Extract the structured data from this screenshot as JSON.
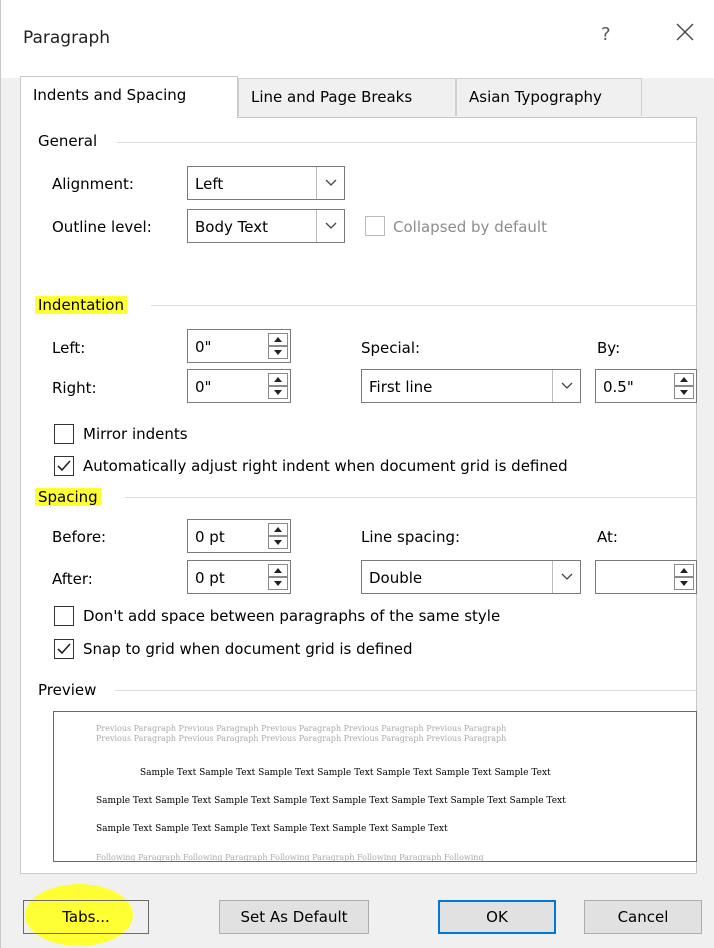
{
  "window": {
    "title": "Paragraph",
    "help_glyph": "?",
    "close_icon": "close-icon"
  },
  "tabs": [
    {
      "label": "Indents and Spacing",
      "active": true
    },
    {
      "label": "Line and Page Breaks",
      "active": false
    },
    {
      "label": "Asian Typography",
      "active": false
    }
  ],
  "general": {
    "heading": "General",
    "alignment_label": "Alignment:",
    "alignment_value": "Left",
    "outline_label": "Outline level:",
    "outline_value": "Body Text",
    "collapsed_label": "Collapsed by default",
    "collapsed_checked": false
  },
  "indentation": {
    "heading": "Indentation",
    "left_label": "Left:",
    "left_value": "0\"",
    "right_label": "Right:",
    "right_value": "0\"",
    "special_label": "Special:",
    "special_value": "First line",
    "by_label": "By:",
    "by_value": "0.5\"",
    "mirror_label": "Mirror indents",
    "mirror_checked": false,
    "auto_adjust_label": "Automatically adjust right indent when document grid is defined",
    "auto_adjust_checked": true
  },
  "spacing": {
    "heading": "Spacing",
    "before_label": "Before:",
    "before_value": "0 pt",
    "after_label": "After:",
    "after_value": "0 pt",
    "line_spacing_label": "Line spacing:",
    "line_spacing_value": "Double",
    "at_label": "At:",
    "at_value": "",
    "no_space_label": "Don't add space between paragraphs of the same style",
    "no_space_checked": false,
    "snap_label": "Snap to grid when document grid is defined",
    "snap_checked": true
  },
  "preview": {
    "heading": "Preview",
    "previous_1": "Previous Paragraph Previous Paragraph Previous Paragraph Previous Paragraph Previous Paragraph",
    "previous_2": "Previous Paragraph Previous Paragraph Previous Paragraph Previous Paragraph Previous Paragraph",
    "sample_1": "Sample Text Sample Text Sample Text Sample Text Sample Text Sample Text Sample Text",
    "sample_2": "Sample Text Sample Text Sample Text Sample Text Sample Text Sample Text Sample Text Sample Text",
    "sample_3": "Sample Text Sample Text Sample Text Sample Text Sample Text Sample Text",
    "following_1": "Following Paragraph Following Paragraph Following Paragraph Following Paragraph Following"
  },
  "buttons": {
    "tabs": "Tabs...",
    "set_default": "Set As Default",
    "ok": "OK",
    "cancel": "Cancel"
  },
  "colors": {
    "highlight": "#ffff33",
    "default_button_border": "#0078d7"
  }
}
